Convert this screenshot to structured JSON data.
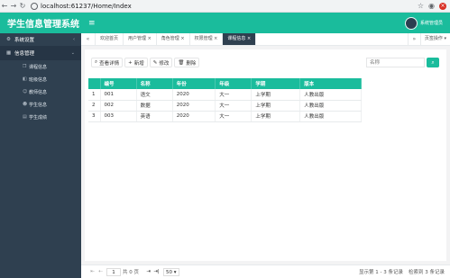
{
  "browser": {
    "back": "←",
    "forward": "→",
    "reload": "↻",
    "url": "localhost:61237/Home/Index"
  },
  "header": {
    "title": "学生信息管理系统",
    "menu_toggle": "≡",
    "user_name": "系统管理员"
  },
  "sidebar": {
    "groups": [
      {
        "label": "系统设置",
        "icon": "gear-icon",
        "glyph": "⚙",
        "chevron": "‹"
      },
      {
        "label": "信息管理",
        "icon": "grid-icon",
        "glyph": "▦",
        "chevron": "⌄"
      }
    ],
    "items": [
      {
        "label": "课程信息",
        "icon": "book-icon",
        "glyph": "❒"
      },
      {
        "label": "班级信息",
        "icon": "class-icon",
        "glyph": "◧"
      },
      {
        "label": "教师信息",
        "icon": "teacher-icon",
        "glyph": "☺"
      },
      {
        "label": "学生信息",
        "icon": "student-icon",
        "glyph": "☻"
      },
      {
        "label": "学生成绩",
        "icon": "score-icon",
        "glyph": "▤"
      }
    ]
  },
  "tabs": {
    "prev": "«",
    "next": "»",
    "items": [
      {
        "label": "欢迎首页"
      },
      {
        "label": "用户管理 ×"
      },
      {
        "label": "角色管理 ×"
      },
      {
        "label": "权限管理 ×"
      },
      {
        "label": "课程信息 ×"
      }
    ],
    "ops": "页签操作 ▾"
  },
  "toolbar": {
    "detail": "查看详情",
    "detail_icon": "⌕",
    "add": "新增",
    "add_icon": "+",
    "edit": "修改",
    "edit_icon": "✎",
    "delete": "删除",
    "delete_icon": "🗑"
  },
  "search": {
    "placeholder": "名称",
    "button_icon": "⌕"
  },
  "table": {
    "columns": [
      "",
      "编号",
      "名称",
      "年份",
      "年级",
      "学期",
      "版本"
    ],
    "rows": [
      [
        "1",
        "001",
        "语文",
        "2020",
        "大一",
        "上学期",
        "人教出版"
      ],
      [
        "2",
        "002",
        "数据",
        "2020",
        "大一",
        "上学期",
        "人教出版"
      ],
      [
        "3",
        "003",
        "英语",
        "2020",
        "大一",
        "上学期",
        "人教出版"
      ]
    ]
  },
  "pager": {
    "first": "⇤",
    "prev": "⇠",
    "page": "1",
    "total_pages": "共 0 页",
    "next": "⇥",
    "last": "⇥|",
    "page_size": "50 ▾",
    "info": "显示第 1 - 3 条记录",
    "info2": "检索到 3 条记录"
  }
}
